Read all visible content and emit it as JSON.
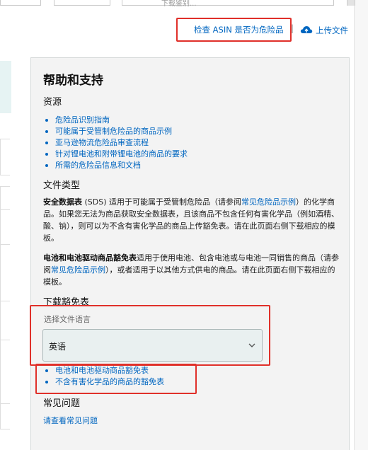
{
  "header": {
    "check_asin_link": "检查 ASIN 是否为危险品",
    "separator": "|",
    "upload_label": "上传文件",
    "top_select_text": "下载鉴别..."
  },
  "help_panel": {
    "title": "帮助和支持",
    "resources_heading": "资源",
    "resources": [
      "危险品识别指南",
      "可能属于受管制危险品的商品示例",
      "亚马逊物流危险品审查流程",
      "针对锂电池和附带锂电池的商品的要求",
      "所需的危险品信息和文档"
    ],
    "file_types_heading": "文件类型",
    "sds_paragraph": {
      "bold": "安全数据表",
      "pre_link": " (SDS) 适用于可能属于受管制危险品（请参阅",
      "link": "常见危险品示例",
      "post_link": "）的化学商品。如果您无法为商品获取安全数据表，且该商品不包含任何有害化学品（例如酒精、酸、钠），则可以为不含有害化学品的商品上传豁免表。请在此页面右侧下载相应的模板。"
    },
    "battery_paragraph": {
      "bold": "电池和电池驱动商品豁免表",
      "pre_link": "适用于使用电池、包含电池或与电池一同销售的商品（请参阅",
      "link": "常见危险品示例",
      "post_link": "），或者适用于以其他方式供电的商品。请在此页面右侧下载相应的模板。"
    },
    "download_heading": "下载豁免表",
    "select_label": "选择文件语言",
    "select_value": "英语",
    "downloads": [
      "电池和电池驱动商品豁免表",
      "不含有害化学品的商品的豁免表"
    ],
    "faq_heading": "常见问题",
    "faq_link": "请查看常见问题"
  },
  "colors": {
    "link": "#0066c0",
    "annotation": "#e0302a",
    "panel_bg": "#f3f3f3",
    "select_bg": "#e9f0f0"
  }
}
